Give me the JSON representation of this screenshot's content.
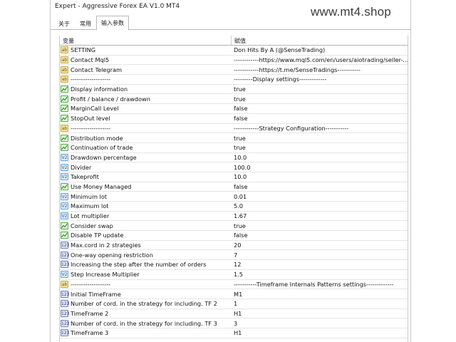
{
  "window": {
    "title": "Expert - Aggressive Forex EA V1.0 MT4",
    "watermark": "www.mt4.shop"
  },
  "tabs": [
    {
      "label": "关于"
    },
    {
      "label": "常用"
    },
    {
      "label": "输入参数"
    }
  ],
  "grid": {
    "col_variable": "变量",
    "col_value": "赋值",
    "rows": [
      {
        "icon": "ab",
        "name": "SETTING",
        "value": "Don Hits By A (@SenseTrading)"
      },
      {
        "icon": "ab",
        "name": "Contact Mql5",
        "value": "------------https://www.mql5.com/en/users/aiotrading/seller-..."
      },
      {
        "icon": "ab",
        "name": "Contact Telegram",
        "value": "------------https://t.me/SenseTradings-----------"
      },
      {
        "icon": "ab",
        "name": "-------------------",
        "value": "---------Display settings-------------"
      },
      {
        "icon": "bool",
        "name": "Display information",
        "value": "true"
      },
      {
        "icon": "bool",
        "name": "Profit / balance / drawdown",
        "value": "true"
      },
      {
        "icon": "bool",
        "name": "MarginCall Level",
        "value": "false"
      },
      {
        "icon": "bool",
        "name": "StopOut level",
        "value": "false"
      },
      {
        "icon": "ab",
        "name": "-------------------",
        "value": "------------Strategy Configuration-----------"
      },
      {
        "icon": "bool",
        "name": "Distribution mode",
        "value": "true"
      },
      {
        "icon": "bool",
        "name": "Continuation of trade",
        "value": "true"
      },
      {
        "icon": "dbl",
        "name": "Drawdown percentage",
        "value": "10.0"
      },
      {
        "icon": "dbl",
        "name": "Divider",
        "value": "100.0"
      },
      {
        "icon": "dbl",
        "name": "Takeprofit",
        "value": "10.0"
      },
      {
        "icon": "bool",
        "name": "Use Money Managed",
        "value": "false"
      },
      {
        "icon": "dbl",
        "name": "Minimum lot",
        "value": "0.01"
      },
      {
        "icon": "dbl",
        "name": "Maximum lot",
        "value": "5.0"
      },
      {
        "icon": "dbl",
        "name": "Lot multiplier",
        "value": "1.67"
      },
      {
        "icon": "bool",
        "name": "Consider swap",
        "value": "true"
      },
      {
        "icon": "bool",
        "name": "Disable TP update",
        "value": "false"
      },
      {
        "icon": "int",
        "name": "Max.cord in 2 strategies",
        "value": "20"
      },
      {
        "icon": "int",
        "name": "One-way opening restriction",
        "value": "7"
      },
      {
        "icon": "int",
        "name": "Increasing the step after the number of orders",
        "value": "12"
      },
      {
        "icon": "dbl",
        "name": "Step Increase Multiplier",
        "value": "1.5"
      },
      {
        "icon": "ab",
        "name": "-------------------",
        "value": "-----------Timeframe Internals Patterns settings-------------"
      },
      {
        "icon": "int",
        "name": "Initial TimeFrame",
        "value": "M1"
      },
      {
        "icon": "int",
        "name": "Number of cord. in the strategy for including. TF 2",
        "value": "1"
      },
      {
        "icon": "int",
        "name": "TimeFrame 2",
        "value": "H1"
      },
      {
        "icon": "int",
        "name": "Number of cord. in the strategy for including. TF 3",
        "value": "3"
      },
      {
        "icon": "int",
        "name": "TimeFrame 3",
        "value": "H1"
      }
    ]
  }
}
